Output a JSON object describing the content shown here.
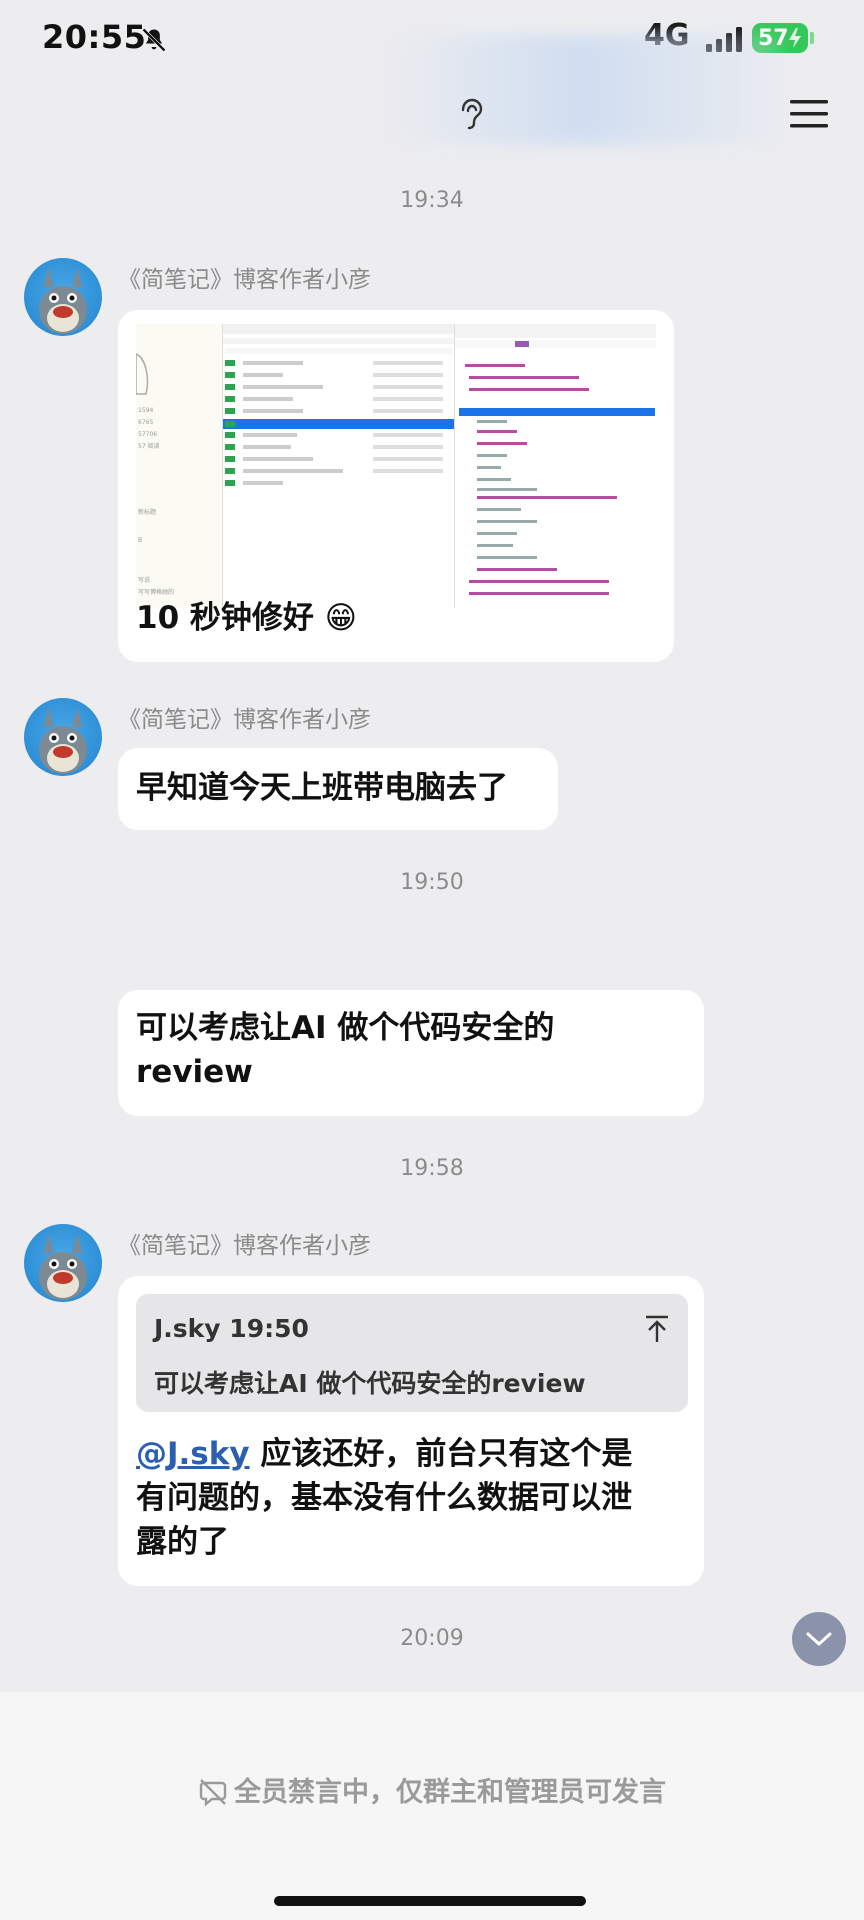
{
  "status_bar": {
    "time": "20:55",
    "network": "4G",
    "battery": "57"
  },
  "messages": [
    {
      "type": "timestamp",
      "text": "19:34"
    },
    {
      "type": "incoming",
      "sender": "《简笔记》博客作者小彦",
      "image_screenshot": true,
      "text": "10 秒钟修好 😁"
    },
    {
      "type": "incoming",
      "sender": "《简笔记》博客作者小彦",
      "text": "早知道今天上班带电脑去了"
    },
    {
      "type": "timestamp",
      "text": "19:50"
    },
    {
      "type": "incoming_no_avatar",
      "line1": "可以考虑让AI 做个代码安全的",
      "line2": "review"
    },
    {
      "type": "timestamp",
      "text": "19:58"
    },
    {
      "type": "incoming",
      "sender": "《简笔记》博客作者小彦",
      "quote": {
        "author_time": "J.sky 19:50",
        "text": "可以考虑让AI 做个代码安全的review"
      },
      "mention": "@J.sky",
      "reply_line1": " 应该还好，前台只有这个是",
      "reply_line2": "有问题的，基本没有什么数据可以泄",
      "reply_line3": "露的了"
    },
    {
      "type": "timestamp",
      "text": "20:09"
    }
  ],
  "footer": {
    "notice": "全员禁言中，仅群主和管理员可发言"
  },
  "icons": [
    "mute-icon",
    "signal-icon",
    "battery-icon",
    "ear-icon",
    "menu-icon",
    "quote-jump-icon",
    "chevron-down-icon",
    "mute-chat-icon"
  ]
}
